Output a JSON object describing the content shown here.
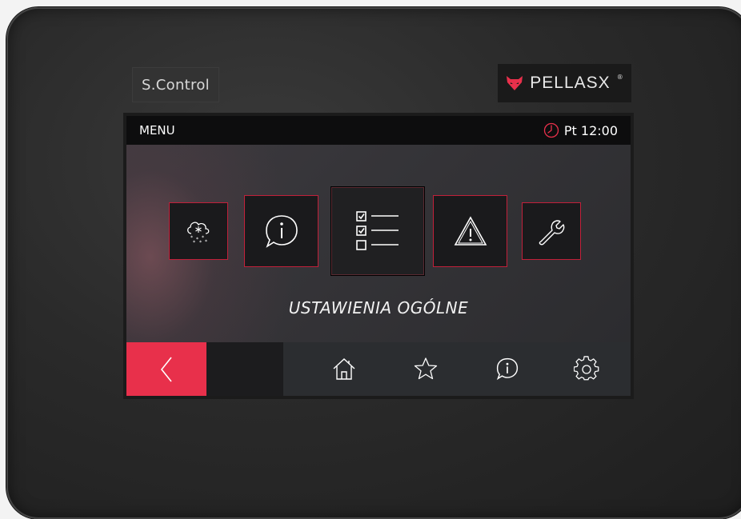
{
  "device": {
    "left_brand": "S.Control",
    "right_brand": "PELLASX",
    "right_brand_mark": "®",
    "brand_icon": "fox-head-icon",
    "accent_color": "#e8304b"
  },
  "topbar": {
    "title": "MENU",
    "clock_icon": "clock-icon",
    "time": "Pt 12:00"
  },
  "menu": {
    "tiles": [
      {
        "id": "winter",
        "icon": "snow-cloud-icon",
        "active": false
      },
      {
        "id": "info",
        "icon": "info-bubble-icon",
        "active": false
      },
      {
        "id": "general-settings",
        "icon": "checklist-icon",
        "active": true
      },
      {
        "id": "alarms",
        "icon": "warning-icon",
        "active": false
      },
      {
        "id": "service",
        "icon": "wrench-icon",
        "active": false
      }
    ],
    "selected_label": "USTAWIENIA OGÓLNE"
  },
  "bottom_nav": {
    "back_icon": "chevron-left-icon",
    "items": [
      "home-icon",
      "star-icon",
      "info-bubble-icon",
      "gear-icon"
    ]
  }
}
